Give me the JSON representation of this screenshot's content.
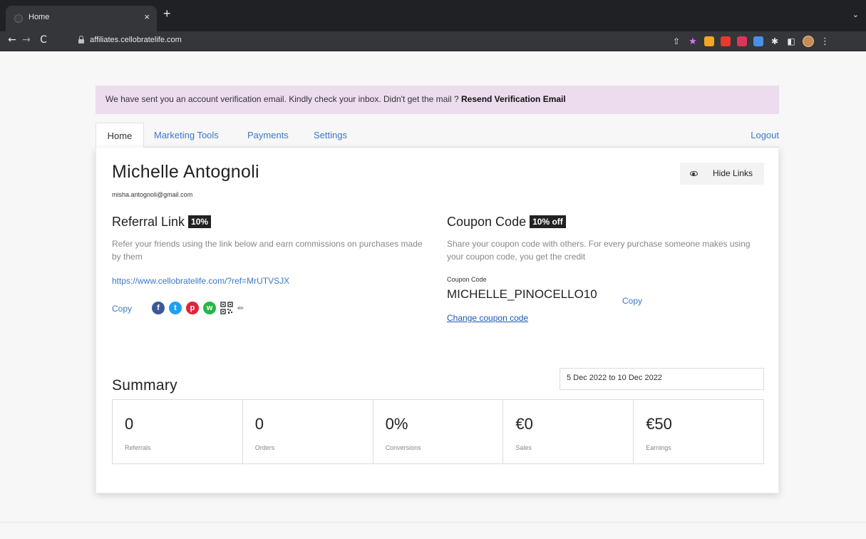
{
  "browser": {
    "tab_title": "Home",
    "tab_close": "×",
    "new_tab": "+",
    "tab_menu": "⌄",
    "url": "affiliates.cellobratelife.com",
    "back": "←",
    "forward": "→",
    "reload": "C",
    "share": "⇧",
    "star": "★",
    "kebab": "⋮",
    "extension_colors": [
      "#f5a623",
      "#e8392b",
      "#d9385a",
      "#4a8fe8"
    ]
  },
  "banner": {
    "text": "We have sent you an account verification email. Kindly check your inbox. Didn't get the mail ? ",
    "action": "Resend Verification Email"
  },
  "tabs": {
    "home": "Home",
    "marketing": "Marketing Tools",
    "payments": "Payments",
    "settings": "Settings",
    "logout": "Logout"
  },
  "profile": {
    "name": "Michelle Antognoli",
    "email": "misha.antognoli@gmail.com",
    "hide_links": "Hide Links"
  },
  "referral": {
    "title": "Referral Link",
    "badge": "10%",
    "description": "Refer your friends using the link below and earn commissions on purchases made by them",
    "link": "https://www.cellobratelife.com/?ref=MrUTVSJX",
    "copy": "Copy",
    "share_icons": [
      "facebook-icon",
      "twitter-icon",
      "pinterest-icon",
      "whatsapp-icon",
      "qr-code-icon",
      "pencil-icon"
    ]
  },
  "coupon": {
    "title": "Coupon Code",
    "badge": "10% off",
    "description": "Share your coupon code with others. For every purchase someone makes using your coupon code, you get the credit",
    "label": "Coupon Code",
    "code": "MICHELLE_PINOCELLO10",
    "copy": "Copy",
    "change": "Change coupon code"
  },
  "summary": {
    "title": "Summary",
    "date_range": "5 Dec 2022 to 10 Dec 2022",
    "stats": [
      {
        "value": "0",
        "label": "Referrals"
      },
      {
        "value": "0",
        "label": "Orders"
      },
      {
        "value": "0%",
        "label": "Conversions"
      },
      {
        "value": "€0",
        "label": "Sales"
      },
      {
        "value": "€50",
        "label": "Earnings"
      }
    ]
  }
}
